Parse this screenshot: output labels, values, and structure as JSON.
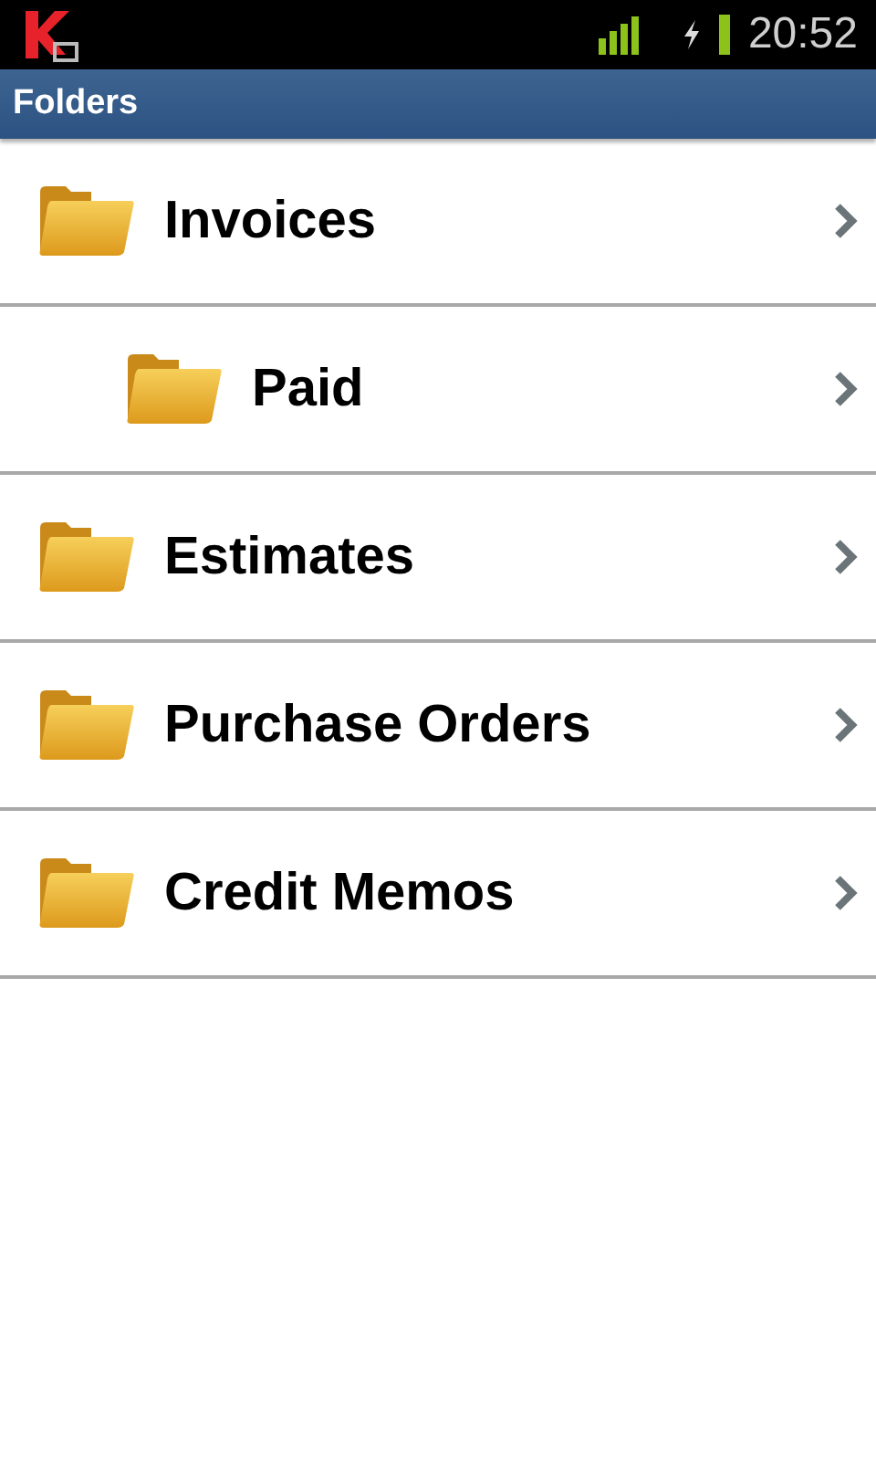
{
  "status_bar": {
    "time": "20:52"
  },
  "title_bar": {
    "title": "Folders"
  },
  "folders": [
    {
      "name": "Invoices",
      "children": [
        {
          "name": "Paid"
        }
      ]
    },
    {
      "name": "Estimates"
    },
    {
      "name": "Purchase Orders"
    },
    {
      "name": "Credit Memos"
    }
  ]
}
